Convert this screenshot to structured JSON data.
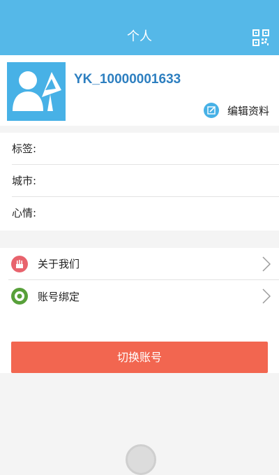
{
  "header": {
    "title": "个人",
    "qr_icon": "qr-code-icon"
  },
  "profile": {
    "avatar_icon": "default-avatar-icon",
    "username": "YK_10000001633",
    "edit_label": "编辑资料",
    "edit_icon": "edit-icon"
  },
  "info": [
    {
      "label": "标签:"
    },
    {
      "label": "城市:"
    },
    {
      "label": "心情:"
    }
  ],
  "menu": [
    {
      "label": "关于我们",
      "icon": "about-icon",
      "icon_color": "#e8636d"
    },
    {
      "label": "账号绑定",
      "icon": "bind-icon",
      "icon_color": "#58a03a"
    }
  ],
  "switch_button": "切换账号",
  "colors": {
    "header": "#55b8e8",
    "accent": "#47b1e6",
    "button": "#f26650",
    "username": "#2d7fc0"
  }
}
